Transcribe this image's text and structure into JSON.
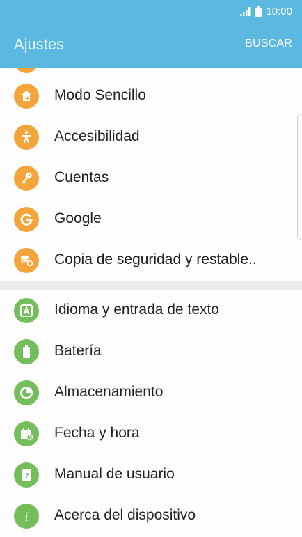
{
  "status_bar": {
    "time": "10:00",
    "icons": [
      "signal-icon",
      "battery-icon"
    ]
  },
  "app_bar": {
    "title": "Ajustes",
    "search_label": "BUSCAR"
  },
  "colors": {
    "app_bar": "#5bb8e0",
    "orange_icon": "#f3a43b",
    "green_icon": "#74bd5b"
  },
  "groups": [
    {
      "items": [
        {
          "label": "Modo Sencillo",
          "icon": "easy-mode-icon"
        },
        {
          "label": "Accesibilidad",
          "icon": "accessibility-icon"
        },
        {
          "label": "Cuentas",
          "icon": "key-icon"
        },
        {
          "label": "Google",
          "icon": "google-icon"
        },
        {
          "label": "Copia de seguridad y restable..",
          "icon": "backup-icon"
        }
      ]
    },
    {
      "items": [
        {
          "label": "Idioma y entrada de texto",
          "icon": "language-icon"
        },
        {
          "label": "Batería",
          "icon": "battery-icon"
        },
        {
          "label": "Almacenamiento",
          "icon": "storage-icon"
        },
        {
          "label": "Fecha y hora",
          "icon": "calendar-icon"
        },
        {
          "label": "Manual de usuario",
          "icon": "manual-icon"
        },
        {
          "label": "Acerca del dispositivo",
          "icon": "info-icon"
        }
      ]
    }
  ]
}
